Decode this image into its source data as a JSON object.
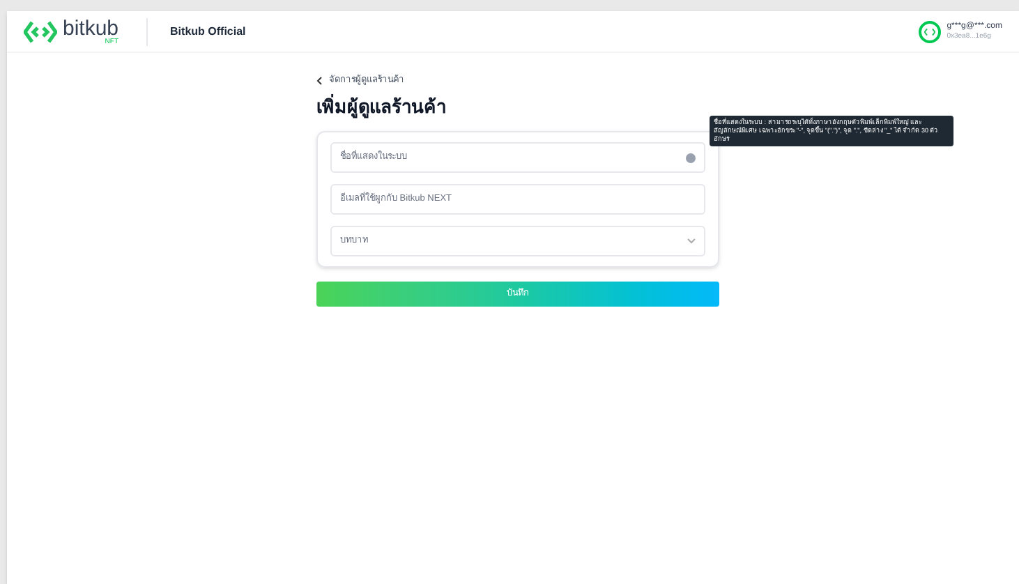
{
  "header": {
    "brand": "bitkub",
    "brand_sub": "NFT",
    "title": "Bitkub Official",
    "user": {
      "email": "g***g@***.com",
      "address": "0x3ea8...1e6g"
    }
  },
  "back_link": "จัดการผู้ดูแลร้านค้า",
  "page_title": "เพิ่มผู้ดูแลร้านค้า",
  "form": {
    "fields": [
      {
        "kind": "text",
        "placeholder": "ชื่อที่แสดงในระบบ",
        "info": true
      },
      {
        "kind": "text",
        "placeholder": "อีเมลที่ใช้ผูกกับ Bitkub NEXT",
        "info": false
      },
      {
        "kind": "select",
        "placeholder": "บทบาท",
        "info": false
      }
    ]
  },
  "tooltip": "ชื่อที่แสดงในระบบ : สามารถระบุได้ทั้งภาษาอังกฤษตัวพิมพ์เล็กพิมพ์ใหญ่ และ สัญลักษณ์พิเศษ เฉพาะอักขระ \"-\", จุดขึ้น \"(\".\")\", จุด \".\", ขีดล่าง \"_\" ได้ จำกัด 30 ตัวอักษร",
  "save_button": "บันทึก"
}
